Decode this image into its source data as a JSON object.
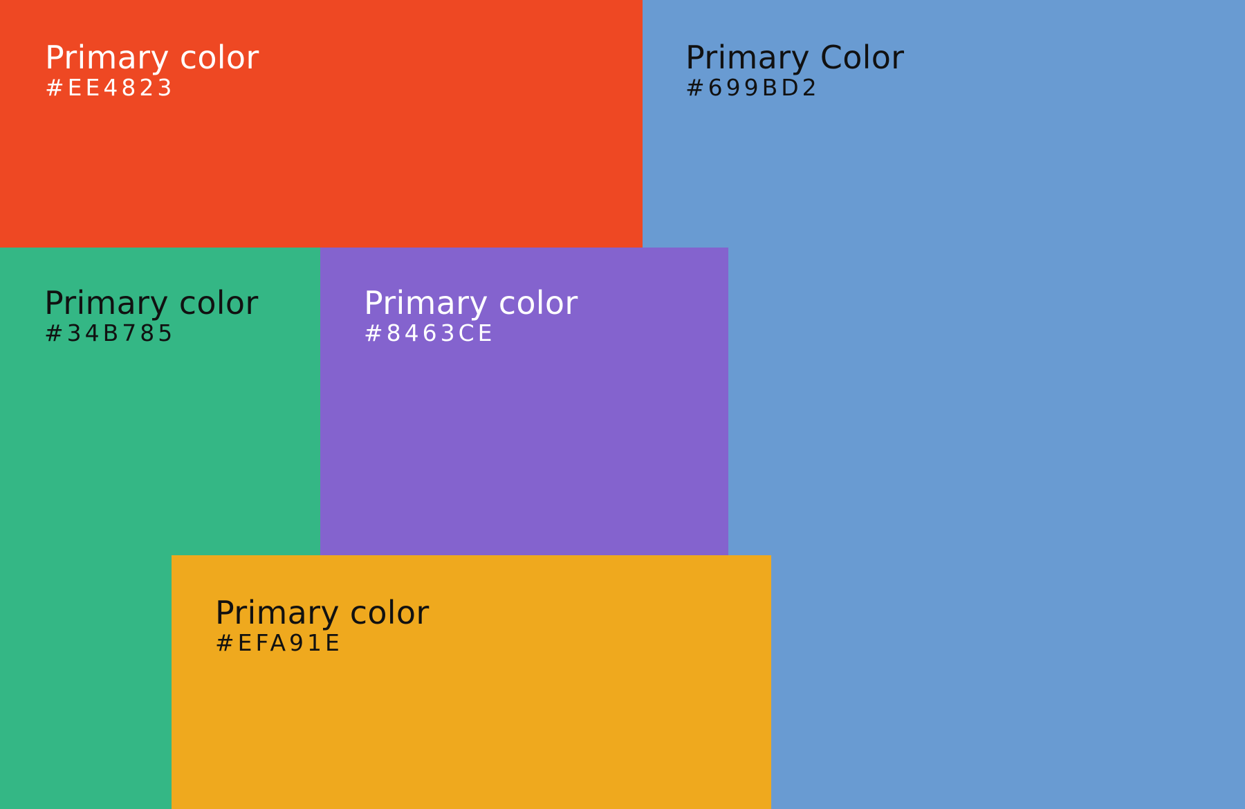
{
  "swatches": [
    {
      "title": "Primary color",
      "hex": "#EE4823",
      "color": "#EE4823",
      "text_color": "#FFFFFF"
    },
    {
      "title": "Primary Color",
      "hex": "#699BD2",
      "color": "#699BD2",
      "text_color": "#111111"
    },
    {
      "title": "Primary color",
      "hex": "#34B785",
      "color": "#34B785",
      "text_color": "#111111"
    },
    {
      "title": "Primary color",
      "hex": "#8463CE",
      "color": "#8463CE",
      "text_color": "#FFFFFF"
    },
    {
      "title": "Primary color",
      "hex": "#EFA91E",
      "color": "#EFA91E",
      "text_color": "#111111"
    }
  ]
}
